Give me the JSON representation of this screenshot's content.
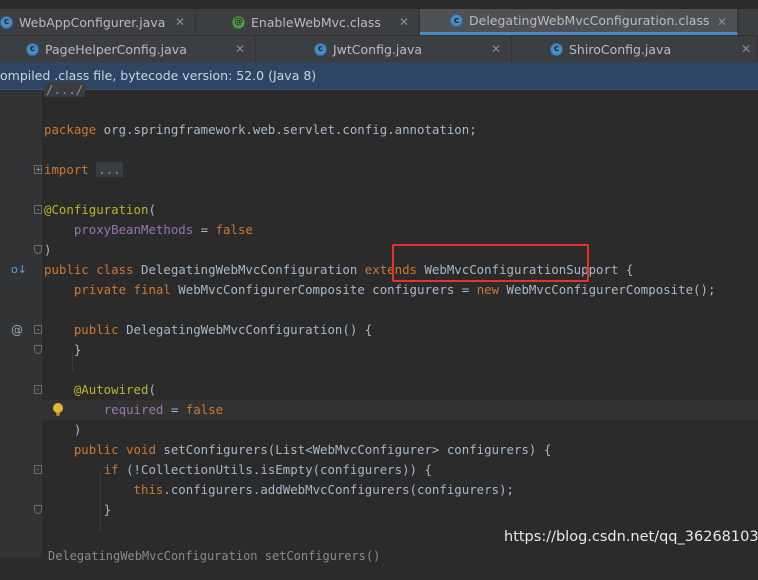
{
  "tabs_row1": [
    {
      "label": "WebAppConfigurer.java",
      "icon": "class-file-icon",
      "active": false,
      "closable": true
    },
    {
      "label": "EnableWebMvc.class",
      "icon": "annotation-file-icon",
      "active": false,
      "closable": true
    },
    {
      "label": "DelegatingWebMvcConfiguration.class",
      "icon": "class-file-icon",
      "active": true,
      "closable": true
    }
  ],
  "tabs_row2": [
    {
      "label": "PageHelperConfig.java",
      "icon": "class-file-icon",
      "active": false,
      "closable": true
    },
    {
      "label": "JwtConfig.java",
      "icon": "class-file-icon",
      "active": false,
      "closable": true
    },
    {
      "label": "ShiroConfig.java",
      "icon": "class-file-icon",
      "active": false,
      "closable": true
    }
  ],
  "close_glyph": "✕",
  "banner_text": "ompiled .class file, bytecode version: 52.0 (Java 8)",
  "code": {
    "top_fold": "/.../",
    "package_kw": "package",
    "package_name": " org.springframework.web.servlet.config.annotation;",
    "import_kw": "import",
    "import_fold": "...",
    "config_annotation": "@Configuration",
    "config_open": "(",
    "proxy_param": "proxyBeanMethods",
    "proxy_eq": " = ",
    "proxy_val": "false",
    "config_close": ")",
    "class_mods": "public class ",
    "class_name": "DelegatingWebMvcConfiguration ",
    "extends_kw": "extends ",
    "super_name": "WebMvcConfigurationSupport",
    "class_brace": " {",
    "field_mods": "private final ",
    "field_type": "WebMvcConfigurerComposite configurers = ",
    "new_kw": "new ",
    "field_init": "WebMvcConfigurerComposite();",
    "ctor_mod": "public ",
    "ctor_sig": "DelegatingWebMvcConfiguration() {",
    "close_brace": "}",
    "autowired": "@Autowired",
    "autowired_open": "(",
    "required_param": "required",
    "required_eq": " = ",
    "required_val": "false",
    "autowired_close": ")",
    "method_mods": "public void ",
    "method_sig": "setConfigurers(List<WebMvcConfigurer> configurers) {",
    "if_kw": "if ",
    "if_cond": "(!CollectionUtils.isEmpty(configurers)) {",
    "this_kw": "this",
    "add_call": ".configurers.addWebMvcConfigurers(configurers);",
    "inner_close": "}",
    "partial_next_line": "DelegatingWebMvcConfiguration  setConfigurers()"
  },
  "gutter": {
    "implemented_marker": "o↓",
    "override_marker": "@"
  },
  "watermark": "https://blog.csdn.net/qq_36268103",
  "colors": {
    "keyword": "#cc7832",
    "annotation": "#bbb529",
    "param": "#9876aa",
    "text": "#a9b7c6",
    "highlight_box": "#e8302c"
  }
}
